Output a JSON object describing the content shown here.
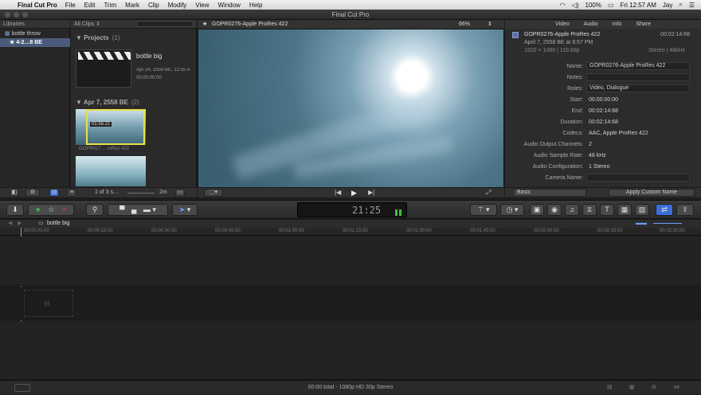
{
  "menubar": {
    "app": "Final Cut Pro",
    "items": [
      "File",
      "Edit",
      "Trim",
      "Mark",
      "Clip",
      "Modify",
      "View",
      "Window",
      "Help"
    ],
    "battery": "100%",
    "clock": "Fri 12:57 AM",
    "user": "Jay"
  },
  "window_title": "Final Cut Pro",
  "libraries": {
    "header": "Libraries",
    "items": [
      "bottle throw",
      "4-2…8 BE"
    ]
  },
  "browser": {
    "filter": "All Clips",
    "projects_label": "Projects",
    "projects_count": "(1)",
    "project": {
      "name": "bottle big",
      "date": "Apr 24, 2558 BE, 12:55 A",
      "duration": "00:00:00:00"
    },
    "event_label": "Apr 7, 2558 BE",
    "event_count": "(2)",
    "clip1_timecode": "01:55:21",
    "clip1_name": "GOPR027….roRes 422",
    "footer_selection": "1 of 3 s…",
    "footer_zoom": "2m"
  },
  "viewer": {
    "title": "GOPR0276-Apple ProRes 422",
    "zoom": "66%"
  },
  "inspector": {
    "tabs": [
      "Video",
      "Audio",
      "Info",
      "Share"
    ],
    "clip_name": "GOPR0276-Apple ProRes 422",
    "clip_duration": "00:02:14:68",
    "clip_date": "April 7, 2558 BE at 8:57 PM",
    "clip_format": "1920 × 1080 | 119.88p",
    "clip_audio": "Stereo | 48kHz",
    "fields": [
      {
        "label": "Name:",
        "value": "GOPR0276-Apple ProRes 422"
      },
      {
        "label": "Notes:",
        "value": ""
      },
      {
        "label": "Roles:",
        "value": "Video, Dialogue"
      },
      {
        "label": "Start:",
        "value": "00:00:00:00"
      },
      {
        "label": "End:",
        "value": "00:02:14:68"
      },
      {
        "label": "Duration:",
        "value": "00:02:14:68"
      },
      {
        "label": "Codecs:",
        "value": "AAC, Apple ProRes 422"
      },
      {
        "label": "Audio Output Channels:",
        "value": "2"
      },
      {
        "label": "Audio Sample Rate:",
        "value": "48 kHz"
      },
      {
        "label": "Audio Configuration:",
        "value": "1 Stereo"
      },
      {
        "label": "Camera Name:",
        "value": ""
      }
    ],
    "metadata_view": "Basic",
    "apply_button": "Apply Custom Name"
  },
  "toolbar": {
    "timecode": "21:25"
  },
  "timeline": {
    "project_name": "bottle big",
    "ruler": [
      "00:00:00:00",
      "00:00:15:00",
      "00:00:30:00",
      "00:00:45:00",
      "00:01:00:00",
      "00:01:15:00",
      "00:01:30:00",
      "00:01:45:00",
      "00:02:00:00",
      "00:02:15:00",
      "00:02:30:00"
    ]
  },
  "status": "00:00 total - 1080p HD 30p Stereo",
  "colors": {
    "accent": "#3a6fd8",
    "selection": "#e8e24a",
    "favorite": "#3fbf3f",
    "reject": "#d23c3c"
  }
}
